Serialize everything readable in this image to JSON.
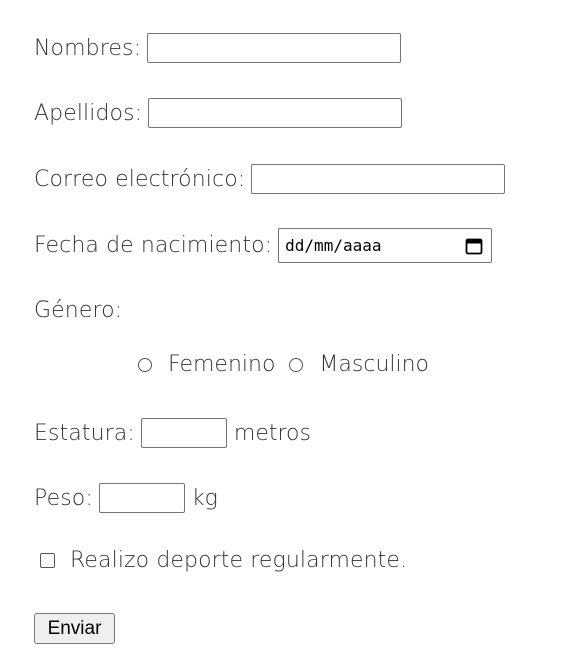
{
  "form": {
    "nombres": {
      "label": "Nombres:",
      "value": ""
    },
    "apellidos": {
      "label": "Apellidos:",
      "value": ""
    },
    "correo": {
      "label": "Correo electrónico:",
      "value": ""
    },
    "fecha": {
      "label": "Fecha de nacimiento:",
      "value": "dd/mm/aaaa",
      "icon": "calendar-icon"
    },
    "genero": {
      "label": "Género:",
      "options": [
        {
          "label": "Femenino",
          "selected": false
        },
        {
          "label": "Masculino",
          "selected": false
        }
      ]
    },
    "estatura": {
      "label": "Estatura:",
      "value": "",
      "unit": "metros"
    },
    "peso": {
      "label": "Peso:",
      "value": "",
      "unit": "kg"
    },
    "deporte": {
      "label": "Realizo deporte regularmente.",
      "checked": false
    },
    "submit_label": "Enviar"
  }
}
